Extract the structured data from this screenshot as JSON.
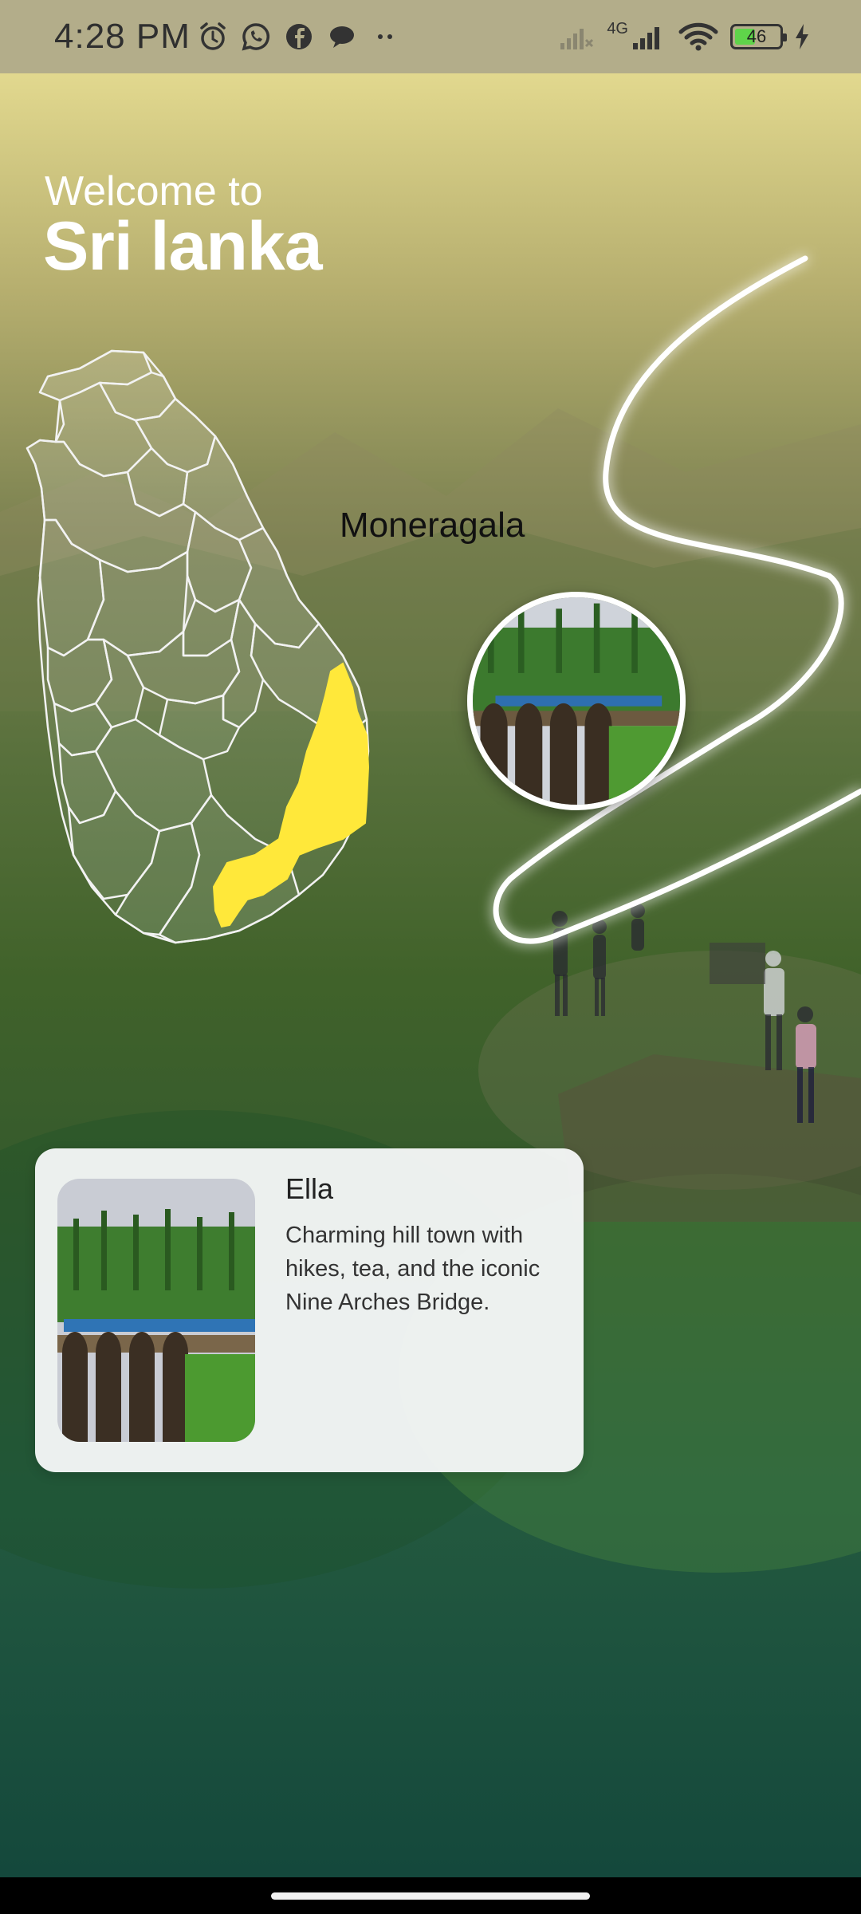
{
  "status_bar": {
    "time": "4:28 PM",
    "network_label": "4G",
    "battery_level": "46",
    "battery_fraction": 0.46,
    "icons": [
      "alarm-icon",
      "whatsapp-icon",
      "facebook-icon",
      "chat-bubble-icon",
      "more-dots-icon",
      "signal-no-service-icon",
      "signal-icon",
      "wifi-icon",
      "battery-icon",
      "charging-icon"
    ]
  },
  "header": {
    "subtitle": "Welcome to",
    "title": "Sri lanka"
  },
  "map": {
    "selected_district": "Moneragala",
    "highlight_color": "#ffe83a",
    "outline_color": "#f2f2f2"
  },
  "card": {
    "title": "Ella",
    "description": "Charming hill town with hikes, tea, and the iconic Nine Arches Bridge."
  },
  "colors": {
    "status_bar": "#b3ad8a",
    "sky_top": "#eee496",
    "forest_bottom": "#14483c",
    "card_bg": "#f5f7f7"
  }
}
